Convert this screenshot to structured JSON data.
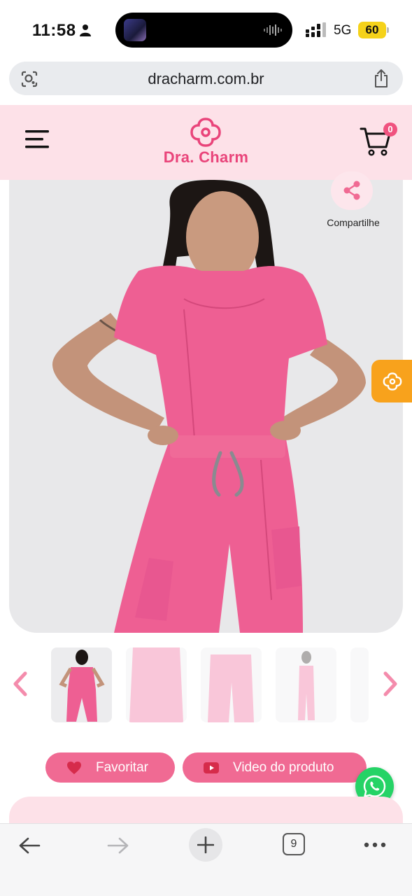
{
  "status_bar": {
    "time": "11:58",
    "network": "5G",
    "battery": "60"
  },
  "browser": {
    "url": "dracharm.com.br",
    "tabs_count": "9"
  },
  "site": {
    "brand": "Dra. Charm",
    "cart_count": "0",
    "brand_color": "#e9447a"
  },
  "product": {
    "share_label": "Compartilhe",
    "thumbnails": 5
  },
  "actions": {
    "favorite_label": "Favoritar",
    "video_label": "Video do produto"
  },
  "colors": {
    "header_bg": "#fde1e8",
    "button_bg": "#f06a93",
    "scrub_pink": "#ee5f93",
    "orange_fab": "#f8a21c",
    "whatsapp": "#25d366"
  },
  "icons": [
    "person-icon",
    "lens-icon",
    "share-icon",
    "menu-icon",
    "logo-flower-icon",
    "cart-icon",
    "share-network-icon",
    "flower-icon",
    "chevron-left-icon",
    "chevron-right-icon",
    "heart-icon",
    "youtube-icon",
    "whatsapp-icon",
    "arrow-left-icon",
    "arrow-right-icon",
    "plus-icon",
    "more-icon"
  ]
}
